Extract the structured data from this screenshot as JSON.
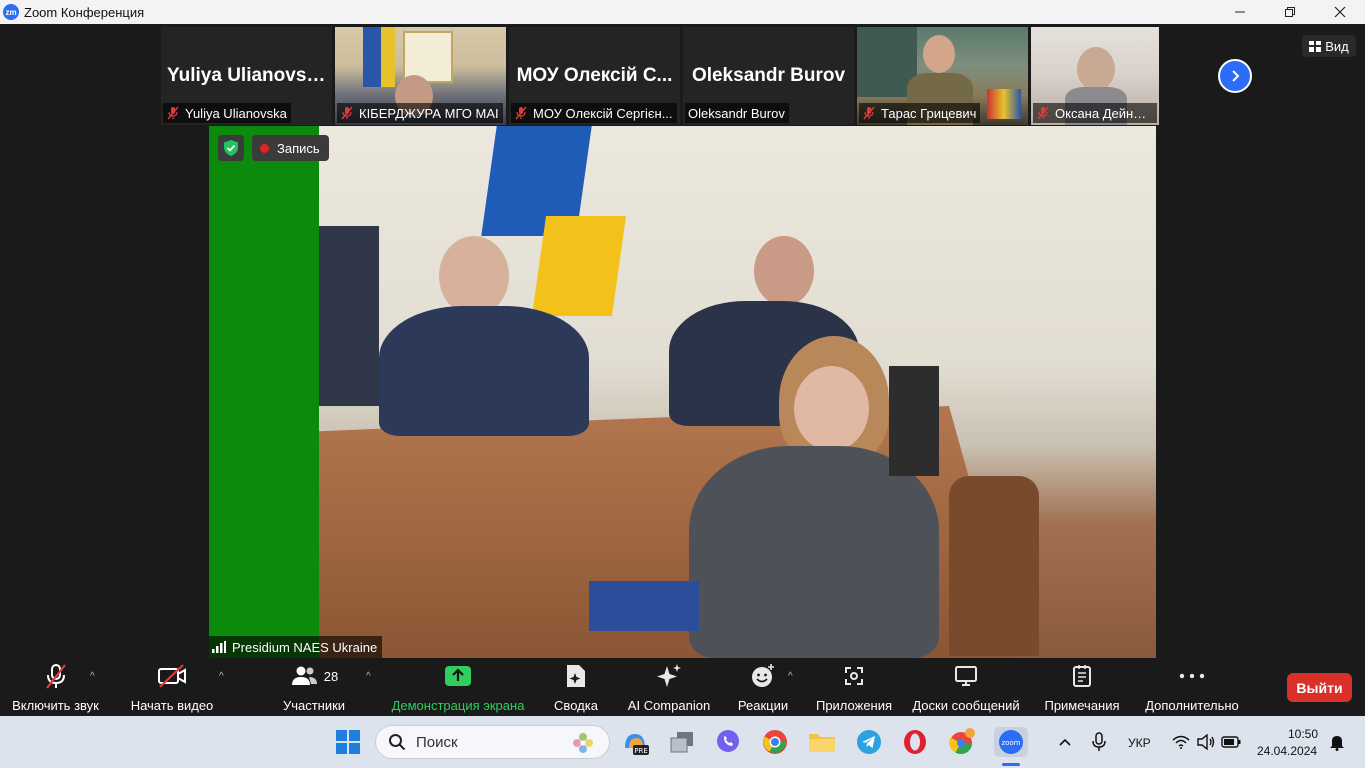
{
  "window": {
    "app_icon": "zm",
    "title": "Zoom Конференция",
    "controls": [
      "minimize-icon",
      "restore-icon",
      "close-icon"
    ]
  },
  "gallery": {
    "tiles": [
      {
        "big_name": "Yuliya Ulianovska",
        "label": "Yuliya Ulianovska",
        "muted": true,
        "video": false
      },
      {
        "big_name": "",
        "label": "КІБЕРДЖУРА МГО МАІ",
        "muted": true,
        "video": true
      },
      {
        "big_name": "МОУ  Олексій С...",
        "label": "МОУ Олексій Сергієн...",
        "muted": true,
        "video": false
      },
      {
        "big_name": "Oleksandr Burov",
        "label": "Oleksandr Burov",
        "muted": false,
        "video": false
      },
      {
        "big_name": "",
        "label": "Тарас Грицевич",
        "muted": true,
        "video": true
      },
      {
        "big_name": "",
        "label": "Оксана Дейнекіна",
        "muted": true,
        "video": true
      }
    ],
    "next_icon": "chevron-right-icon",
    "view_label": "Вид"
  },
  "main_video": {
    "recording_label": "Запись",
    "speaker_name": "Presidium NAES Ukraine"
  },
  "toolbar": {
    "unmute": "Включить звук",
    "start_video": "Начать видео",
    "participants_count": "28",
    "participants": "Участники",
    "share_screen": "Демонстрация экрана",
    "summary": "Сводка",
    "ai_companion": "AI Companion",
    "reactions": "Реакции",
    "apps": "Приложения",
    "whiteboards": "Доски сообщений",
    "notes": "Примечания",
    "more": "Дополнительно",
    "leave": "Выйти",
    "accent_share": "#2fce5e",
    "accent_leave": "#d9302a"
  },
  "taskbar": {
    "search_placeholder": "Поиск",
    "language": "УКР",
    "time": "10:50",
    "date": "24.04.2024"
  }
}
